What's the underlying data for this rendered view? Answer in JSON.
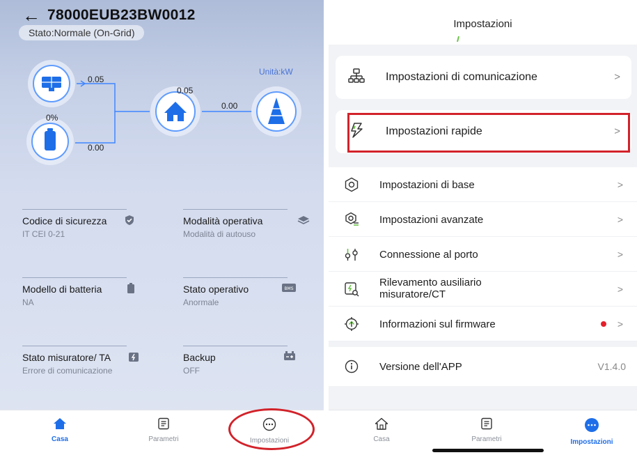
{
  "left": {
    "device_id": "78000EUB23BW0012",
    "status": "Stato:Normale (On-Grid)",
    "unit": "Unità:kW",
    "flow": {
      "pv_value": "0.05",
      "home_value": "0.05",
      "grid_value": "0.00",
      "battery_soc": "0%",
      "battery_value": "0.00"
    },
    "params": [
      {
        "title": "Codice di sicurezza",
        "value": "IT CEI 0-21",
        "icon": "shield-icon"
      },
      {
        "title": "Modalità operativa",
        "value": "Modalità di autouso",
        "icon": "layers-icon"
      },
      {
        "title": "Modello di batteria",
        "value": "NA",
        "icon": "battery-icon"
      },
      {
        "title": "Stato operativo",
        "value": "Anormale",
        "icon": "bms-icon"
      },
      {
        "title": "Stato misuratore/ TA",
        "value": "Errore di comunicazione",
        "icon": "meter-icon"
      },
      {
        "title": "Backup",
        "value": "OFF",
        "icon": "backup-battery-icon"
      }
    ],
    "bms_text": "BMS",
    "tabs": [
      {
        "label": "Casa",
        "icon": "home-icon"
      },
      {
        "label": "Parametri",
        "icon": "document-icon"
      },
      {
        "label": "Impostazioni",
        "icon": "more-icon"
      }
    ]
  },
  "right": {
    "title": "Impostazioni",
    "cards": [
      {
        "label": "Impostazioni di comunicazione",
        "icon": "network-icon"
      },
      {
        "label": "Impostazioni rapide",
        "icon": "lightning-icon"
      }
    ],
    "list": [
      {
        "label": "Impostazioni di base",
        "icon": "gear-icon"
      },
      {
        "label": "Impostazioni avanzate",
        "icon": "advanced-gear-icon"
      },
      {
        "label": "Connessione al porto",
        "icon": "port-icon"
      },
      {
        "label": "Rilevamento ausiliario misuratore/CT",
        "icon": "meter-detect-icon"
      },
      {
        "label": "Informazioni sul firmware",
        "icon": "firmware-icon"
      }
    ],
    "version_label": "Versione dell'APP",
    "version_value": "V1.4.0",
    "chevron": ">",
    "tabs": [
      {
        "label": "Casa",
        "icon": "home-icon"
      },
      {
        "label": "Parametri",
        "icon": "document-icon"
      },
      {
        "label": "Impostazioni",
        "icon": "more-icon"
      }
    ]
  },
  "colors": {
    "accent": "#1e6ee8",
    "highlight": "#d2222a",
    "badge": "#e4202b"
  }
}
